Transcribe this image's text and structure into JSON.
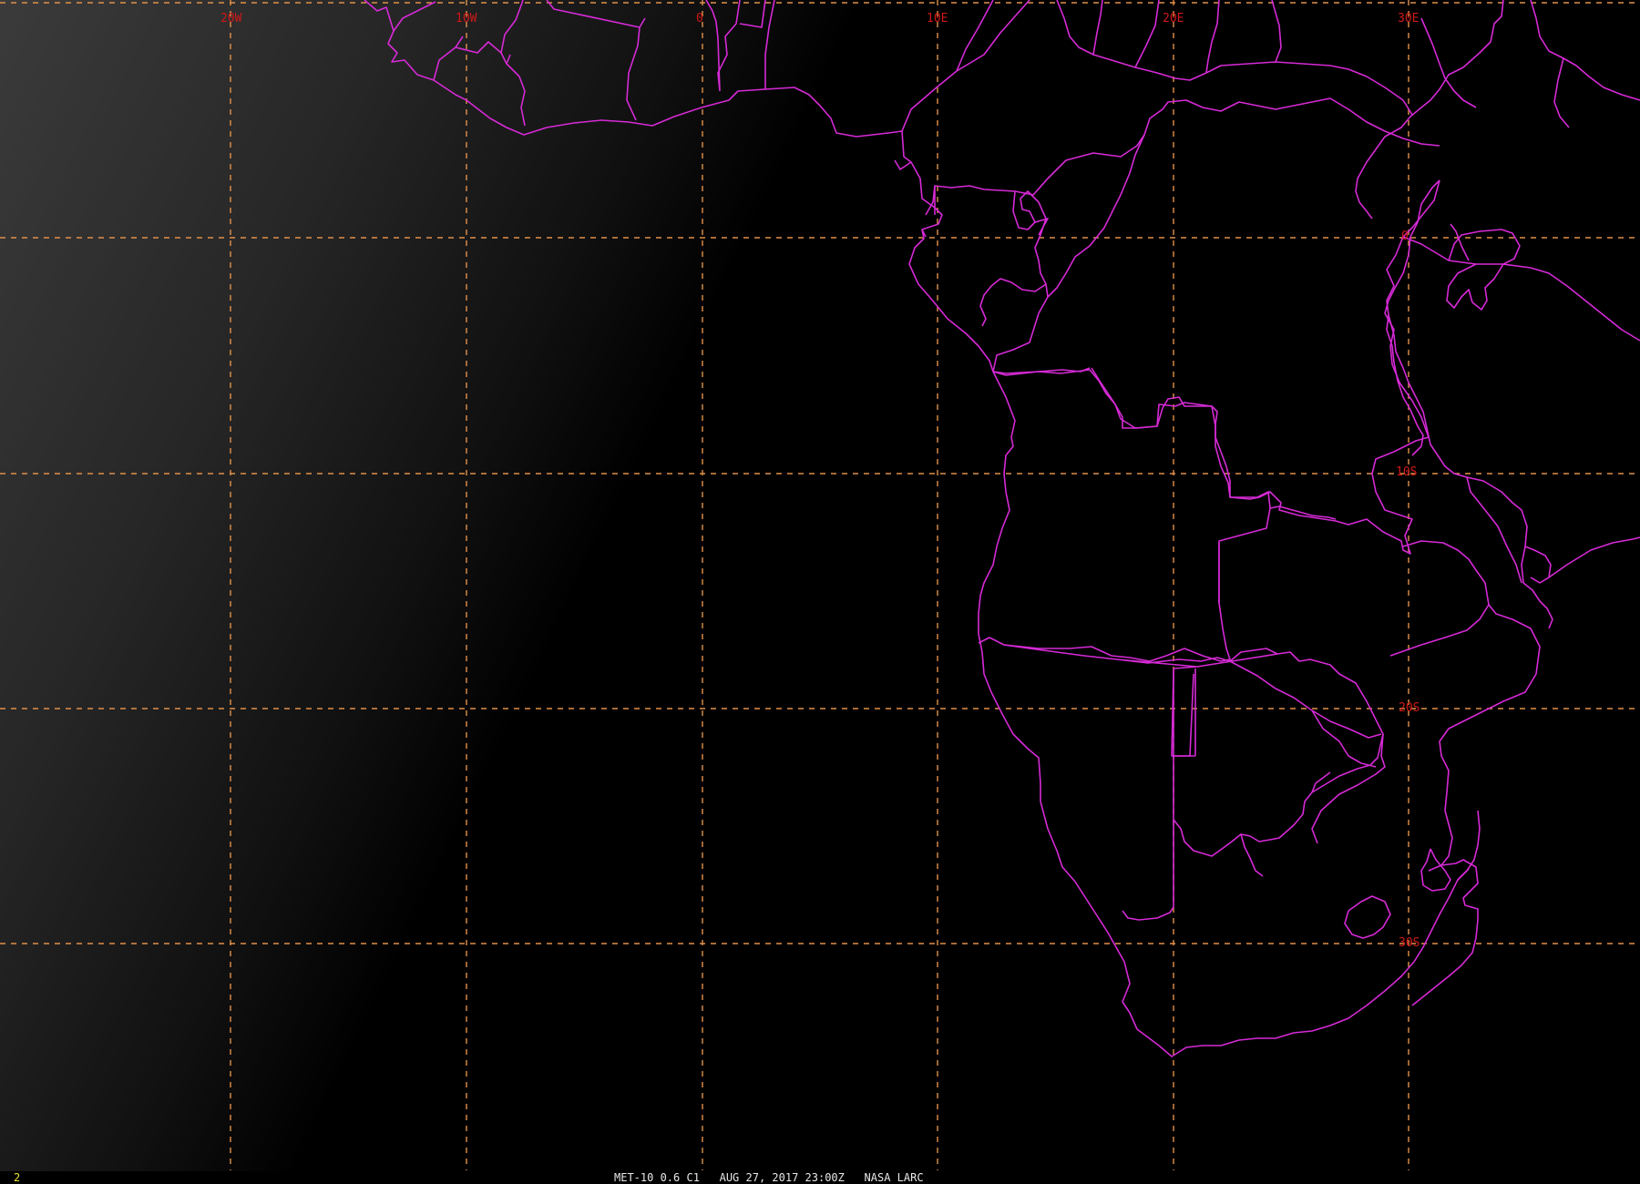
{
  "map": {
    "longitude_labels": [
      "20W",
      "10W",
      "0",
      "10E",
      "20E",
      "30E"
    ],
    "latitude_labels": [
      "0",
      "10S",
      "20S",
      "30S"
    ],
    "colors": {
      "background_dark": "#000000",
      "night_gradient_light": "#3a3a3a",
      "border": "#d62ad6",
      "grid": "#e0904a",
      "grid_label": "#d01818"
    }
  },
  "status_bar": {
    "frame_number": "2",
    "caption": "MET-10 0.6 C1   AUG 27, 2017 23:00Z   NASA LARC"
  }
}
